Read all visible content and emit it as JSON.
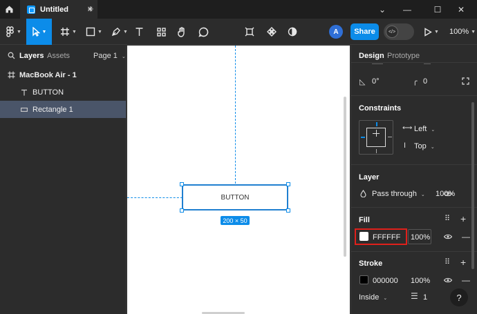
{
  "titlebar": {
    "tab_title": "Untitled",
    "tab_close": "✕",
    "new_tab": "+",
    "window": {
      "chevron": "⌄",
      "minimize": "—",
      "maximize": "☐",
      "close": "✕"
    }
  },
  "toolbar": {
    "avatar_initial": "A",
    "share_label": "Share",
    "zoom_label": "100%"
  },
  "left_panel": {
    "tabs": {
      "layers": "Layers",
      "assets": "Assets",
      "page": "Page 1"
    },
    "layers": [
      {
        "label": "MacBook Air - 1",
        "icon": "frame-icon"
      },
      {
        "label": "BUTTON",
        "icon": "text-icon"
      },
      {
        "label": "Rectangle 1",
        "icon": "rectangle-icon",
        "selected": true
      }
    ]
  },
  "canvas": {
    "button_text": "BUTTON",
    "size_badge": "200 × 50"
  },
  "right_panel": {
    "tabs": {
      "design": "Design",
      "prototype": "Prototype"
    },
    "rotation": {
      "angle": "0°",
      "radius": "0"
    },
    "constraints": {
      "title": "Constraints",
      "horizontal": "Left",
      "vertical": "Top"
    },
    "layer": {
      "title": "Layer",
      "blend": "Pass through",
      "opacity": "100%"
    },
    "fill": {
      "title": "Fill",
      "hex": "FFFFFF",
      "opacity": "100%",
      "color": "#FFFFFF"
    },
    "stroke": {
      "title": "Stroke",
      "hex": "000000",
      "opacity": "100%",
      "color": "#000000",
      "position": "Inside",
      "weight": "1"
    },
    "help": "?"
  },
  "colors": {
    "accent": "#0c8ce9",
    "highlight": "#e0201b"
  }
}
